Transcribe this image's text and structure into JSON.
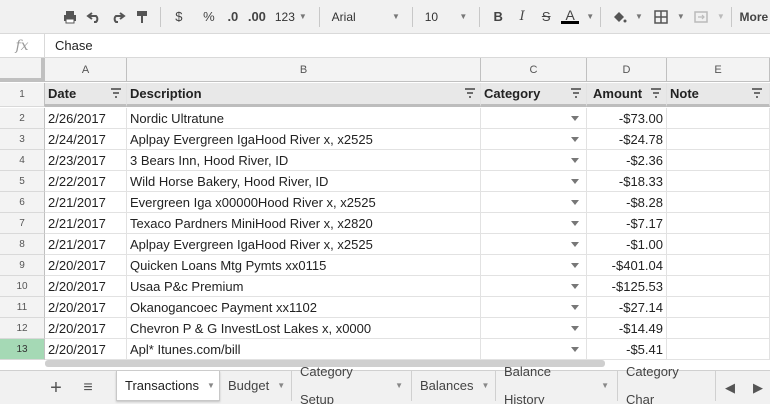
{
  "toolbar": {
    "dollar": "$",
    "percent": "%",
    "decrease_decimal": ".0",
    "increase_decimal": ".00",
    "more_formats": "123",
    "font": "Arial",
    "font_size": "10",
    "bold": "B",
    "italic": "I",
    "strike": "S",
    "text_color": "A",
    "more": "More"
  },
  "formula_bar": {
    "fx_label": "fx",
    "value": "Chase"
  },
  "columns": [
    "A",
    "B",
    "C",
    "D",
    "E"
  ],
  "header_row": {
    "row_number": "1",
    "date": "Date",
    "description": "Description",
    "category": "Category",
    "amount": "Amount",
    "note": "Note"
  },
  "rows": [
    {
      "n": "2",
      "date": "2/26/2017",
      "desc": "Nordic Ultratune",
      "amount": "-$73.00"
    },
    {
      "n": "3",
      "date": "2/24/2017",
      "desc": "Aplpay Evergreen IgaHood River x, x2525",
      "amount": "-$24.78"
    },
    {
      "n": "4",
      "date": "2/23/2017",
      "desc": "3 Bears Inn, Hood River, ID",
      "amount": "-$2.36"
    },
    {
      "n": "5",
      "date": "2/22/2017",
      "desc": "Wild Horse Bakery, Hood River, ID",
      "amount": "-$18.33"
    },
    {
      "n": "6",
      "date": "2/21/2017",
      "desc": "Evergreen Iga x00000Hood River x, x2525",
      "amount": "-$8.28"
    },
    {
      "n": "7",
      "date": "2/21/2017",
      "desc": "Texaco Pardners MiniHood River x, x2820",
      "amount": "-$7.17"
    },
    {
      "n": "8",
      "date": "2/21/2017",
      "desc": "Aplpay Evergreen IgaHood River x, x2525",
      "amount": "-$1.00"
    },
    {
      "n": "9",
      "date": "2/20/2017",
      "desc": "Quicken Loans Mtg Pymts xx0115",
      "amount": "-$401.04"
    },
    {
      "n": "10",
      "date": "2/20/2017",
      "desc": "Usaa P&c Premium",
      "amount": "-$125.53"
    },
    {
      "n": "11",
      "date": "2/20/2017",
      "desc": "Okanogancoec Payment xx1102",
      "amount": "-$27.14"
    },
    {
      "n": "12",
      "date": "2/20/2017",
      "desc": "Chevron P & G InvestLost Lakes x, x0000",
      "amount": "-$14.49"
    },
    {
      "n": "13",
      "date": "2/20/2017",
      "desc": "Apl* Itunes.com/bill",
      "amount": "-$5.41"
    }
  ],
  "sheet_tabs": {
    "add": "+",
    "list": "≡",
    "tabs": [
      "Transactions",
      "Budget",
      "Category Setup",
      "Balances",
      "Balance History",
      "Category Char"
    ],
    "prev": "◀",
    "next": "▶"
  },
  "colors": {
    "active_row": "#a5d9b5",
    "header_bg": "#e8e8e8"
  }
}
